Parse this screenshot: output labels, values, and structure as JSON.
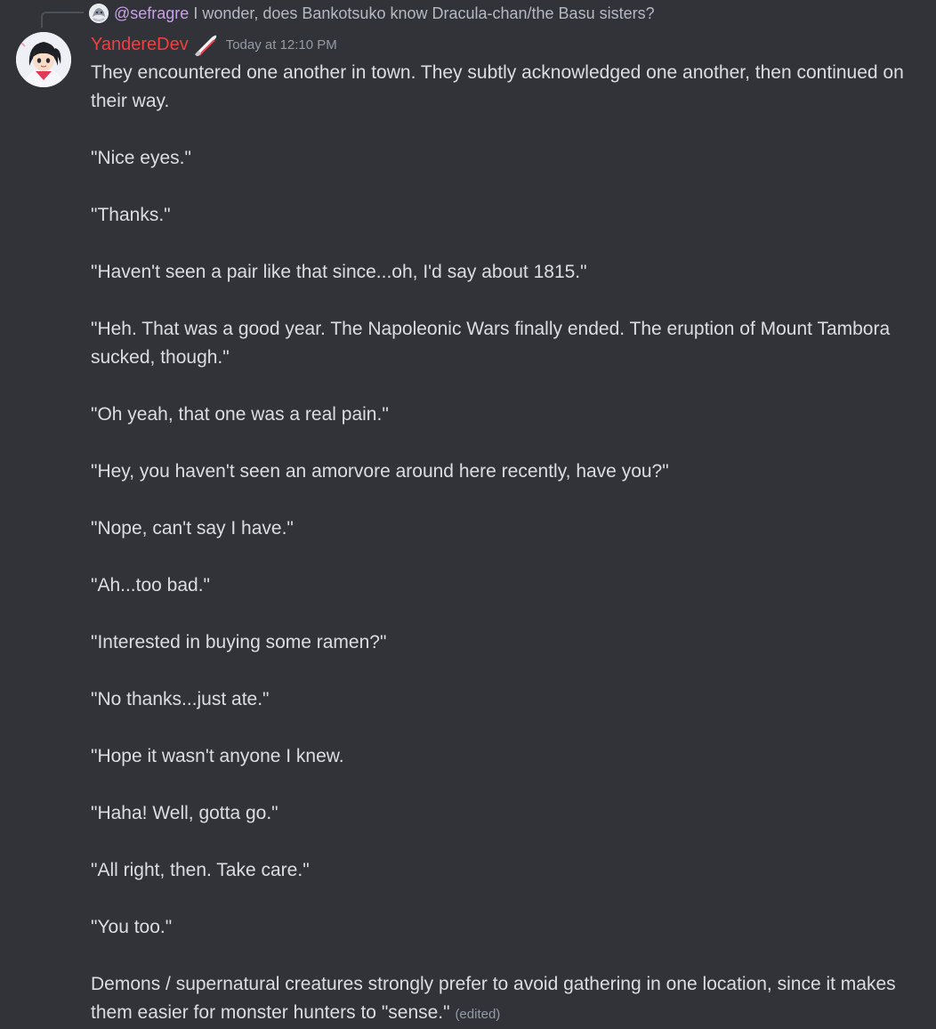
{
  "reply": {
    "mention": "@sefragre",
    "text": "I wonder, does Bankotsuko know Dracula-chan/the Basu sisters?"
  },
  "message": {
    "username": "YandereDev",
    "timestamp": "Today at 12:10 PM",
    "paragraphs": [
      "They encountered one another in town. They subtly acknowledged one another, then continued on their way.",
      "\"Nice eyes.\"",
      "\"Thanks.\"",
      "\"Haven't seen a pair like that since...oh, I'd say about 1815.\"",
      "\"Heh. That was a good year. The Napoleonic Wars finally ended. The eruption of Mount Tambora sucked, though.\"",
      "\"Oh yeah, that one was a real pain.\"",
      "\"Hey, you haven't seen an amorvore around here recently, have you?\"",
      "\"Nope, can't say I have.\"",
      "\"Ah...too bad.\"",
      "\"Interested in buying some ramen?\"",
      "\"No thanks...just ate.\"",
      "\"Hope it wasn't anyone I knew.",
      "\"Haha! Well, gotta go.\"",
      "\"All right, then. Take care.\"",
      "\"You too.\""
    ],
    "last_paragraph": "Demons / supernatural creatures strongly prefer to avoid gathering in one location, since it makes them easier for monster hunters to \"sense.\"",
    "edited_label": "(edited)"
  },
  "colors": {
    "background": "#313338",
    "username": "#f23f42",
    "mention": "#c9a1e8",
    "text": "#dbdee1",
    "muted": "#949ba4"
  },
  "icons": {
    "reply_avatar": "reply-avatar-icon",
    "avatar": "user-avatar",
    "role": "knife-icon"
  }
}
